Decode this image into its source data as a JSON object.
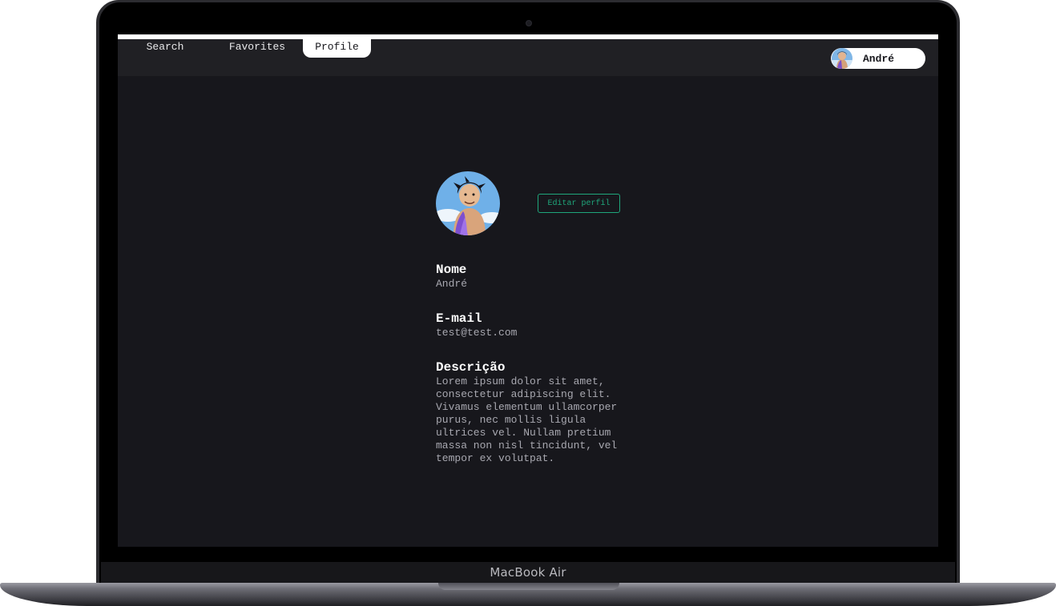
{
  "device": {
    "brand_label": "MacBook Air"
  },
  "navbar": {
    "tabs": [
      {
        "label": "Search"
      },
      {
        "label": "Favorites"
      },
      {
        "label": "Profile",
        "active": true
      }
    ],
    "user": {
      "name": "André",
      "avatar_icon": "user-avatar-icon"
    }
  },
  "profile": {
    "edit_button_label": "Editar perfil",
    "fields": [
      {
        "label": "Nome",
        "value": "André"
      },
      {
        "label": "E-mail",
        "value": "test@test.com"
      },
      {
        "label": "Descrição",
        "value": "Lorem ipsum dolor sit amet, consectetur adipiscing elit. Vivamus elementum ullamcorper purus, nec mollis ligula ultrices vel. Nullam pretium massa non nisl tincidunt, vel tempor ex volutpat."
      }
    ]
  },
  "colors": {
    "background": "#17171c",
    "navbar": "#202024",
    "accent": "#1fa77b",
    "text_primary": "#ffffff",
    "text_secondary": "#a8a8b0"
  }
}
